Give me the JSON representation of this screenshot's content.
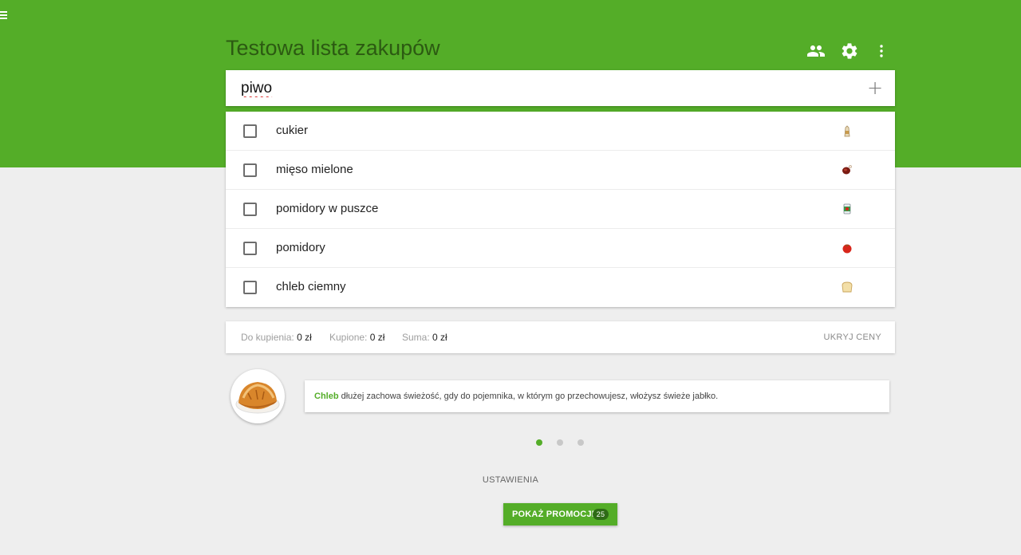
{
  "header": {
    "title": "Testowa lista zakupów",
    "color": "#54ad28",
    "icons": [
      "menu-icon",
      "people-icon",
      "gear-icon",
      "more-vert-icon"
    ]
  },
  "new_item": {
    "value": "piwo",
    "add_icon": "plus-icon"
  },
  "items": [
    {
      "label": "cukier",
      "checked": false,
      "icon": "sugar-icon"
    },
    {
      "label": "mięso mielone",
      "checked": false,
      "icon": "meat-icon"
    },
    {
      "label": "pomidory w puszce",
      "checked": false,
      "icon": "tomato-can-icon"
    },
    {
      "label": "pomidory",
      "checked": false,
      "icon": "tomato-icon"
    },
    {
      "label": "chleb ciemny",
      "checked": false,
      "icon": "bread-icon"
    }
  ],
  "summary": {
    "to_buy_label": "Do kupienia:",
    "to_buy_value": "0 zł",
    "bought_label": "Kupione:",
    "bought_value": "0 zł",
    "total_label": "Suma:",
    "total_value": "0 zł",
    "hide_prices": "UKRYJ CENY"
  },
  "tip": {
    "highlight": "Chleb",
    "text": " dłużej zachowa świeżość, gdy do pojemnika, w którym go przechowujesz, włożysz świeże jabłko.",
    "image": "bread-loaf-image",
    "active_page": 1,
    "pages": 3
  },
  "footer": {
    "settings": "USTAWIENIA",
    "promo_label": "POKAŻ PROMOCJE",
    "promo_count": "25"
  }
}
